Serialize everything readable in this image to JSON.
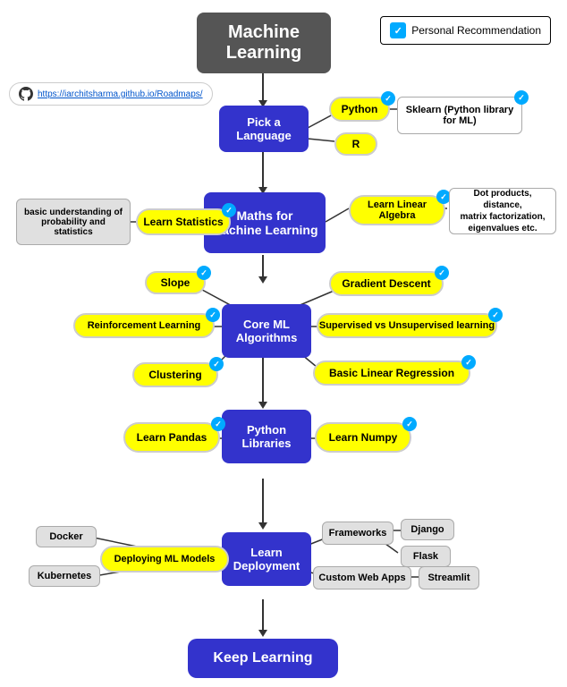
{
  "title": "Machine Learning",
  "legend": {
    "label": "Personal Recommendation",
    "check": "✓"
  },
  "github": {
    "url": "https://iarchitsharma.github.io/Roadmaps/"
  },
  "nodes": {
    "machine_learning": {
      "label": "Machine\nLearning"
    },
    "pick_language": {
      "label": "Pick a\nLanguage"
    },
    "python": {
      "label": "Python"
    },
    "r": {
      "label": "R"
    },
    "sklearn": {
      "label": "Sklearn (Python library\nfor ML)"
    },
    "maths_ml": {
      "label": "Maths for\nMachine Learning"
    },
    "learn_statistics": {
      "label": "Learn Statistics"
    },
    "basic_prob": {
      "label": "basic understanding of\nprobability and\nstatistics"
    },
    "learn_linear_algebra": {
      "label": "Learn Linear\nAlgebra"
    },
    "dot_products": {
      "label": "Dot products, distance,\nmatrix factorization,\neigenvalues etc."
    },
    "core_ml": {
      "label": "Core ML\nAlgorithms"
    },
    "slope": {
      "label": "Slope"
    },
    "gradient_descent": {
      "label": "Gradient Descent"
    },
    "reinforcement_learning": {
      "label": "Reinforcement Learning"
    },
    "supervised_unsupervised": {
      "label": "Supervised vs Unsupervised learning"
    },
    "clustering": {
      "label": "Clustering"
    },
    "basic_linear_regression": {
      "label": "Basic Linear Regression"
    },
    "python_libraries": {
      "label": "Python\nLibraries"
    },
    "learn_pandas": {
      "label": "Learn Pandas"
    },
    "learn_numpy": {
      "label": "Learn Numpy"
    },
    "learn_deployment": {
      "label": "Learn\nDeployment"
    },
    "deploying_ml": {
      "label": "Deploying ML Models"
    },
    "docker": {
      "label": "Docker"
    },
    "kubernetes": {
      "label": "Kubernetes"
    },
    "frameworks": {
      "label": "Frameworks"
    },
    "django": {
      "label": "Django"
    },
    "flask": {
      "label": "Flask"
    },
    "custom_web_apps": {
      "label": "Custom Web Apps"
    },
    "streamlit": {
      "label": "Streamlit"
    },
    "keep_learning": {
      "label": "Keep Learning"
    }
  }
}
